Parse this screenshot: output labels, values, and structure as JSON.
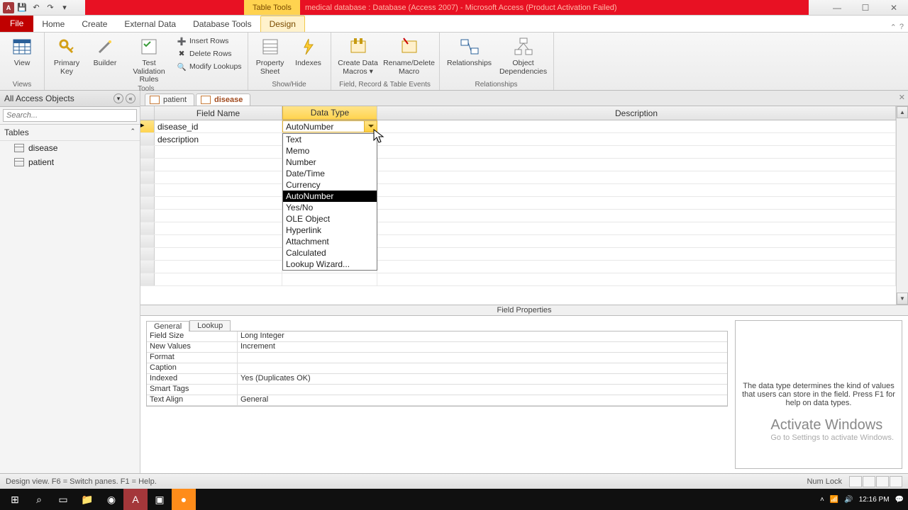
{
  "title": {
    "contextual_tab": "Table Tools",
    "doc": "medical database : Database (Access 2007) - Microsoft Access (Product Activation Failed)"
  },
  "tabs": {
    "file": "File",
    "home": "Home",
    "create": "Create",
    "external": "External Data",
    "dbtools": "Database Tools",
    "design": "Design"
  },
  "ribbon": {
    "views": {
      "view": "View",
      "group": "Views"
    },
    "tools": {
      "pk": "Primary\nKey",
      "builder": "Builder",
      "test": "Test Validation\nRules",
      "insert": "Insert Rows",
      "delete": "Delete Rows",
      "modify": "Modify Lookups",
      "group": "Tools"
    },
    "showhide": {
      "prop": "Property\nSheet",
      "idx": "Indexes",
      "group": "Show/Hide"
    },
    "events": {
      "cdm": "Create Data\nMacros ▾",
      "rdm": "Rename/Delete\nMacro",
      "group": "Field, Record & Table Events"
    },
    "rel": {
      "rel": "Relationships",
      "dep": "Object\nDependencies",
      "group": "Relationships"
    }
  },
  "nav": {
    "header": "All Access Objects",
    "search_placeholder": "Search...",
    "group": "Tables",
    "items": [
      "disease",
      "patient"
    ]
  },
  "doc_tabs": [
    "patient",
    "disease"
  ],
  "grid": {
    "cols": {
      "fname": "Field Name",
      "dtype": "Data Type",
      "desc": "Description"
    },
    "rows": [
      {
        "fname": "disease_id",
        "dtype": "AutoNumber"
      },
      {
        "fname": "description",
        "dtype": ""
      }
    ]
  },
  "dropdown": {
    "options": [
      "Text",
      "Memo",
      "Number",
      "Date/Time",
      "Currency",
      "AutoNumber",
      "Yes/No",
      "OLE Object",
      "Hyperlink",
      "Attachment",
      "Calculated",
      "Lookup Wizard..."
    ],
    "selected": "AutoNumber"
  },
  "fieldprops": {
    "label": "Field Properties",
    "tabs": {
      "general": "General",
      "lookup": "Lookup"
    },
    "rows": [
      {
        "k": "Field Size",
        "v": "Long Integer"
      },
      {
        "k": "New Values",
        "v": "Increment"
      },
      {
        "k": "Format",
        "v": ""
      },
      {
        "k": "Caption",
        "v": ""
      },
      {
        "k": "Indexed",
        "v": "Yes (Duplicates OK)"
      },
      {
        "k": "Smart Tags",
        "v": ""
      },
      {
        "k": "Text Align",
        "v": "General"
      }
    ],
    "help": "The data type determines the kind of values that users can store in the field. Press F1 for help on data types."
  },
  "status": {
    "left": "Design view.   F6 = Switch panes.   F1 = Help.",
    "numlock": "Num Lock"
  },
  "watermark": {
    "big": "Activate Windows",
    "small": "Go to Settings to activate Windows."
  },
  "tray": {
    "time": "12:16 PM"
  }
}
